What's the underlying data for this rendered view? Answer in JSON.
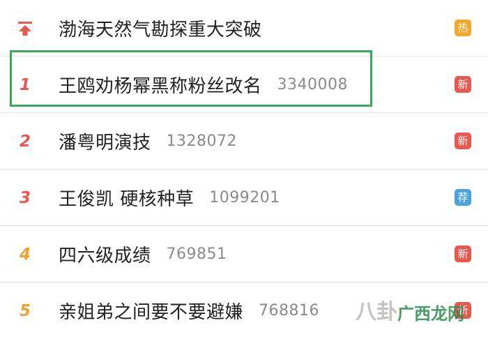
{
  "items": [
    {
      "rank": "",
      "rank_icon": "pin-top-icon",
      "title": "渤海天然气勘探重大突破",
      "count": "",
      "badge": "热",
      "badge_color": "#f3a72b"
    },
    {
      "rank": "1",
      "title": "王鸥劝杨幂黑称粉丝改名",
      "count": "3340008",
      "badge": "新",
      "badge_color": "#e8584f"
    },
    {
      "rank": "2",
      "title": "潘粤明演技",
      "count": "1328072",
      "badge": "新",
      "badge_color": "#e8584f"
    },
    {
      "rank": "3",
      "title": "王俊凯 硬核种草",
      "count": "1099201",
      "badge": "荐",
      "badge_color": "#4aa3df"
    },
    {
      "rank": "4",
      "title": "四六级成绩",
      "count": "769851",
      "badge": "新",
      "badge_color": "#e8584f"
    },
    {
      "rank": "5",
      "title": "亲姐弟之间要不要避嫌",
      "count": "768816",
      "badge": "新",
      "badge_color": "#e8584f"
    }
  ],
  "watermark": {
    "text_left": "八卦",
    "text_right": "广西龙网"
  },
  "colors": {
    "accent_red": "#e8584f",
    "accent_orange": "#f0a030",
    "highlight_green": "#3aa658"
  }
}
